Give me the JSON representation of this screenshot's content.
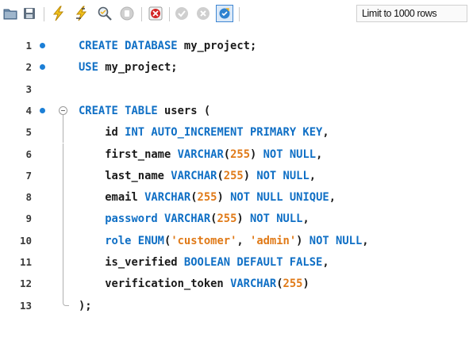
{
  "toolbar": {
    "icons": [
      {
        "name": "open-folder-icon",
        "interactable": true
      },
      {
        "name": "save-icon",
        "interactable": true
      },
      {
        "name": "execute-icon",
        "interactable": true
      },
      {
        "name": "execute-current-icon",
        "interactable": true
      },
      {
        "name": "explain-icon",
        "interactable": true
      },
      {
        "name": "stop-icon",
        "interactable": true
      },
      {
        "name": "toggle-error-icon",
        "interactable": true
      },
      {
        "name": "commit-icon",
        "interactable": true
      },
      {
        "name": "rollback-icon",
        "interactable": true
      },
      {
        "name": "autocommit-icon",
        "interactable": true
      }
    ],
    "limit_label": "Limit to 1000 rows"
  },
  "colors": {
    "keyword": "#0f6fc5",
    "literal": "#e07a18",
    "identifier": "#1a1a1a",
    "dot": "#1c7fd6"
  },
  "editor": {
    "lines": [
      {
        "num": "1",
        "dot": true,
        "fold": "",
        "tokens": [
          [
            "k",
            "CREATE DATABASE"
          ],
          [
            "t",
            " my_project;"
          ]
        ]
      },
      {
        "num": "2",
        "dot": true,
        "fold": "",
        "tokens": [
          [
            "k",
            "USE"
          ],
          [
            "t",
            " my_project;"
          ]
        ]
      },
      {
        "num": "3",
        "dot": false,
        "fold": "",
        "tokens": []
      },
      {
        "num": "4",
        "dot": true,
        "fold": "start",
        "tokens": [
          [
            "k",
            "CREATE TABLE"
          ],
          [
            "t",
            " users ("
          ]
        ]
      },
      {
        "num": "5",
        "dot": false,
        "fold": "mid",
        "tokens": [
          [
            "t",
            "    id "
          ],
          [
            "k",
            "INT AUTO_INCREMENT PRIMARY KEY"
          ],
          [
            "t",
            ","
          ]
        ]
      },
      {
        "num": "6",
        "dot": false,
        "fold": "mid",
        "tokens": [
          [
            "t",
            "    first_name "
          ],
          [
            "k",
            "VARCHAR"
          ],
          [
            "t",
            "("
          ],
          [
            "n",
            "255"
          ],
          [
            "t",
            ") "
          ],
          [
            "k",
            "NOT NULL"
          ],
          [
            "t",
            ","
          ]
        ]
      },
      {
        "num": "7",
        "dot": false,
        "fold": "mid",
        "tokens": [
          [
            "t",
            "    last_name "
          ],
          [
            "k",
            "VARCHAR"
          ],
          [
            "t",
            "("
          ],
          [
            "n",
            "255"
          ],
          [
            "t",
            ") "
          ],
          [
            "k",
            "NOT NULL"
          ],
          [
            "t",
            ","
          ]
        ]
      },
      {
        "num": "8",
        "dot": false,
        "fold": "mid",
        "tokens": [
          [
            "t",
            "    email "
          ],
          [
            "k",
            "VARCHAR"
          ],
          [
            "t",
            "("
          ],
          [
            "n",
            "255"
          ],
          [
            "t",
            ") "
          ],
          [
            "k",
            "NOT NULL UNIQUE"
          ],
          [
            "t",
            ","
          ]
        ]
      },
      {
        "num": "9",
        "dot": false,
        "fold": "mid",
        "tokens": [
          [
            "t",
            "    "
          ],
          [
            "k",
            "password VARCHAR"
          ],
          [
            "t",
            "("
          ],
          [
            "n",
            "255"
          ],
          [
            "t",
            ") "
          ],
          [
            "k",
            "NOT NULL"
          ],
          [
            "t",
            ","
          ]
        ]
      },
      {
        "num": "10",
        "dot": false,
        "fold": "mid",
        "tokens": [
          [
            "t",
            "    "
          ],
          [
            "k",
            "role ENUM"
          ],
          [
            "t",
            "("
          ],
          [
            "s",
            "'customer'"
          ],
          [
            "t",
            ", "
          ],
          [
            "s",
            "'admin'"
          ],
          [
            "t",
            ") "
          ],
          [
            "k",
            "NOT NULL"
          ],
          [
            "t",
            ","
          ]
        ]
      },
      {
        "num": "11",
        "dot": false,
        "fold": "mid",
        "tokens": [
          [
            "t",
            "    is_verified "
          ],
          [
            "k",
            "BOOLEAN DEFAULT FALSE"
          ],
          [
            "t",
            ","
          ]
        ]
      },
      {
        "num": "12",
        "dot": false,
        "fold": "mid",
        "tokens": [
          [
            "t",
            "    verification_token "
          ],
          [
            "k",
            "VARCHAR"
          ],
          [
            "t",
            "("
          ],
          [
            "n",
            "255"
          ],
          [
            "t",
            ")"
          ]
        ]
      },
      {
        "num": "13",
        "dot": false,
        "fold": "end",
        "tokens": [
          [
            "t",
            ");"
          ]
        ]
      }
    ]
  }
}
